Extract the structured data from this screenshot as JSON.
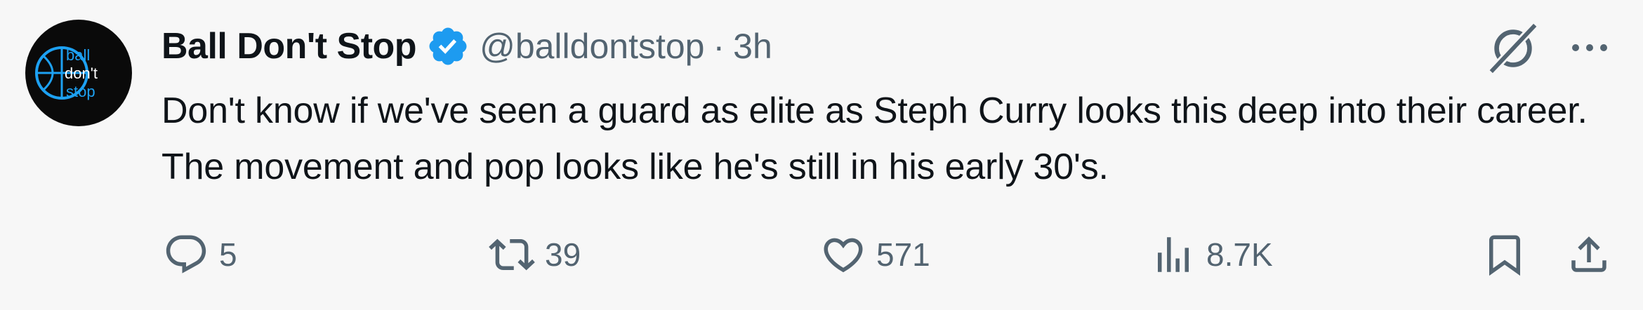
{
  "author": {
    "display_name": "Ball Don't Stop",
    "handle": "@balldontstop",
    "verified": true,
    "avatar_text": [
      "ball",
      "don't",
      "stop"
    ]
  },
  "meta": {
    "separator": "·",
    "time": "3h"
  },
  "tweet": {
    "text": "Don't know if we've seen a guard as elite as Steph Curry looks this deep into their career. The movement and pop looks like he's still in his early 30's."
  },
  "actions": {
    "reply_count": "5",
    "retweet_count": "39",
    "like_count": "571",
    "views_count": "8.7K"
  },
  "icons": {
    "verified": "verified-badge-icon",
    "grok": "grok-icon",
    "more": "more-dots-icon",
    "reply": "reply-icon",
    "retweet": "retweet-icon",
    "like": "heart-icon",
    "views": "views-chart-icon",
    "bookmark": "bookmark-icon",
    "share": "share-icon"
  },
  "colors": {
    "background": "#f7f7f7",
    "verified": "#1d9bf0",
    "secondary_text": "#536471",
    "primary_text": "#0f1419",
    "avatar_bg": "#0a0a0a",
    "avatar_accent": "#1da1f2"
  }
}
